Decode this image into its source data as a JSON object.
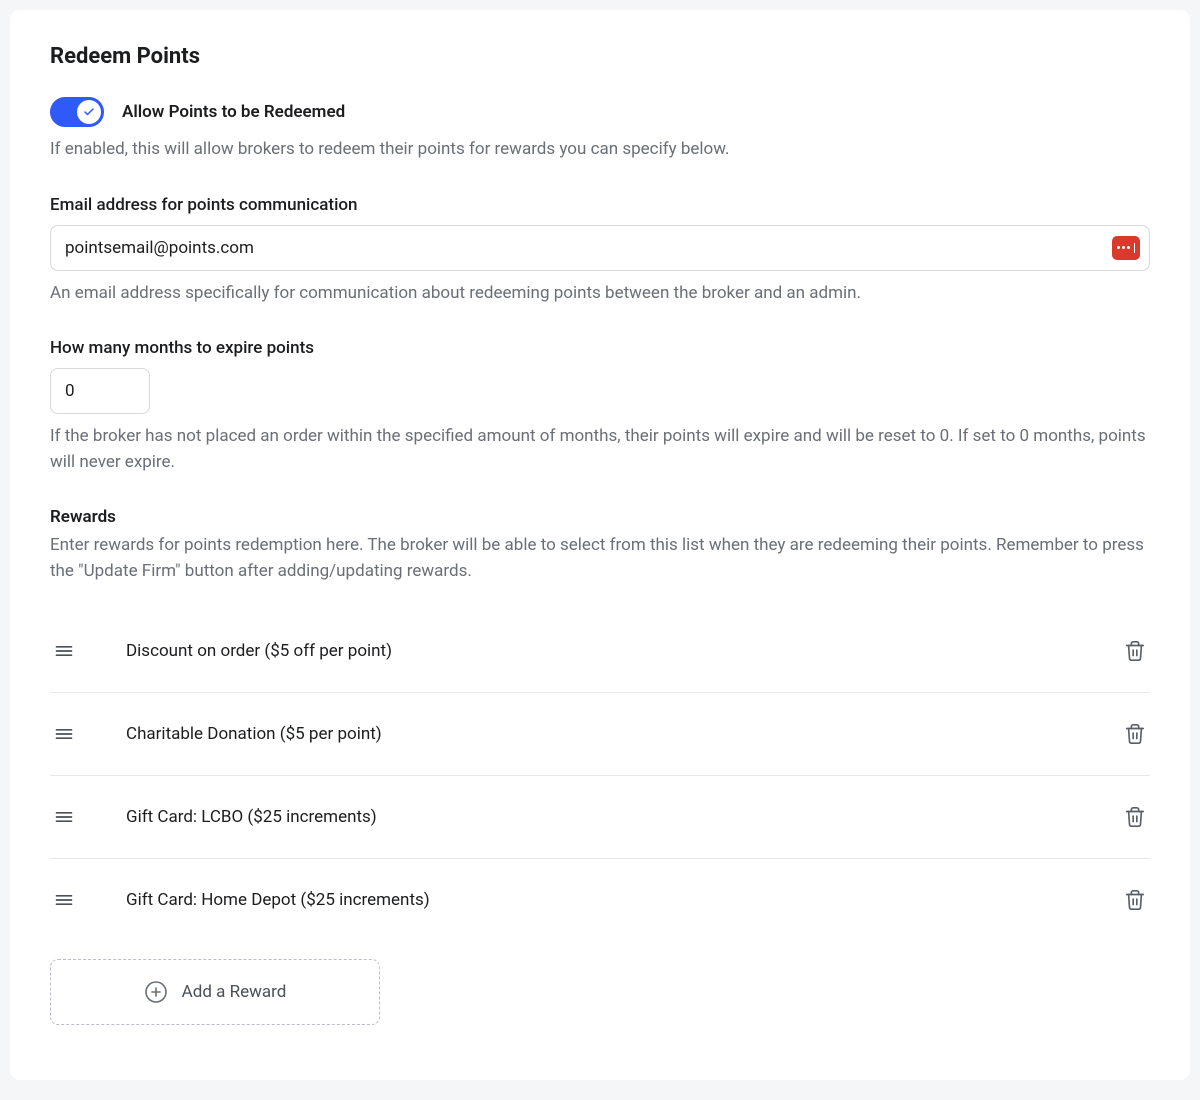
{
  "title": "Redeem Points",
  "allowRedeem": {
    "label": "Allow Points to be Redeemed",
    "helptext": "If enabled, this will allow brokers to redeem their points for rewards you can specify below."
  },
  "emailField": {
    "label": "Email address for points communication",
    "value": "pointsemail@points.com",
    "helptext": "An email address specifically for communication about redeeming points between the broker and an admin."
  },
  "expireField": {
    "label": "How many months to expire points",
    "value": "0",
    "helptext": "If the broker has not placed an order within the specified amount of months, their points will expire and will be reset to 0. If set to 0 months, points will never expire."
  },
  "rewardsSection": {
    "heading": "Rewards",
    "helptext": "Enter rewards for points redemption here. The broker will be able to select from this list when they are redeeming their points. Remember to press the \"Update Firm\" button after adding/updating rewards.",
    "items": [
      {
        "label": "Discount on order ($5 off per point)"
      },
      {
        "label": "Charitable Donation ($5 per point)"
      },
      {
        "label": "Gift Card: LCBO ($25 increments)"
      },
      {
        "label": "Gift Card: Home Depot ($25 increments)"
      }
    ],
    "addButtonLabel": "Add a Reward"
  }
}
